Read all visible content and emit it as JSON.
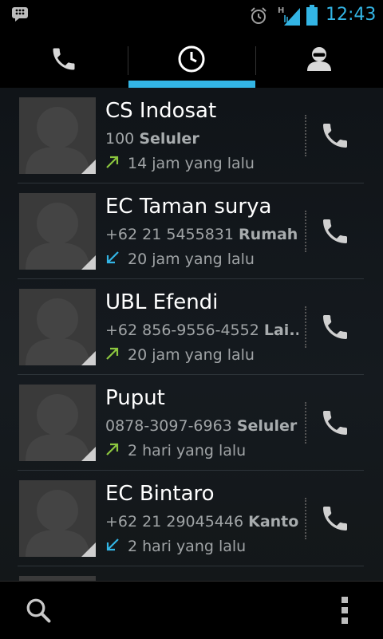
{
  "status_bar": {
    "time": "12:43",
    "network_type": "H",
    "icons": [
      "blackberry-messenger-icon",
      "alarm-icon",
      "signal-icon",
      "battery-icon"
    ]
  },
  "tabs": [
    {
      "icon": "phone-icon",
      "selected": false
    },
    {
      "icon": "recent-calls-icon",
      "selected": true
    },
    {
      "icon": "contacts-icon",
      "selected": false
    }
  ],
  "calls": [
    {
      "name": "CS Indosat",
      "number": "100",
      "label": "Seluler",
      "time": "14 jam yang lalu",
      "type": "outgoing"
    },
    {
      "name": "EC Taman surya",
      "number": "+62 21 5455831",
      "label": "Rumah",
      "time": "20 jam yang lalu",
      "type": "incoming"
    },
    {
      "name": "UBL Efendi",
      "number": "+62 856-9556-4552",
      "label": "Lai..",
      "time": "20 jam yang lalu",
      "type": "outgoing"
    },
    {
      "name": "Puput",
      "number": "0878-3097-6963",
      "label": "Seluler",
      "time": "2 hari yang lalu",
      "type": "outgoing"
    },
    {
      "name": "EC Bintaro",
      "number": "+62 21 29045446",
      "label": "Kantor",
      "time": "2 hari yang lalu",
      "type": "incoming"
    }
  ],
  "colors": {
    "accent": "#33b5e5",
    "outgoing": "#8cc63f",
    "incoming": "#33b5e5"
  },
  "bottom_bar": {
    "left_icon": "search-icon",
    "right_icon": "overflow-menu-icon"
  }
}
